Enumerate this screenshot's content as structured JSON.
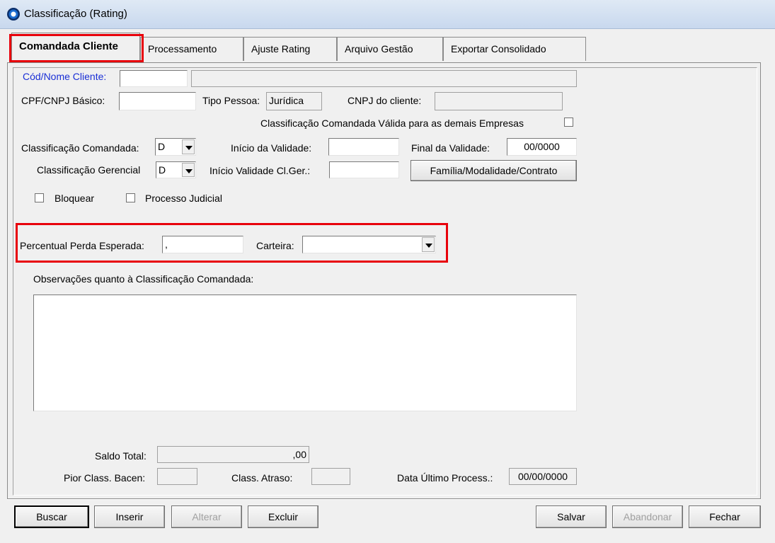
{
  "window": {
    "title": "Classificação (Rating)"
  },
  "tabs": [
    {
      "label": "Comandada Cliente"
    },
    {
      "label": "Processamento"
    },
    {
      "label": "Ajuste Rating"
    },
    {
      "label": "Arquivo Gestão"
    },
    {
      "label": "Exportar Consolidado"
    }
  ],
  "form": {
    "cod_nome_cliente_label": "Cód/Nome Cliente:",
    "cod_cliente_value": "",
    "nome_cliente_value": "",
    "cpf_cnpj_label": "CPF/CNPJ Básico:",
    "cpf_cnpj_value": "",
    "tipo_pessoa_label": "Tipo Pessoa:",
    "tipo_pessoa_value": "Jurídica",
    "cnpj_cliente_label": "CNPJ do cliente:",
    "cnpj_cliente_value": "",
    "classif_valida_label": "Classificação Comandada Válida para as demais Empresas",
    "classif_comandada_label": "Classificação Comandada:",
    "classif_comandada_value": "D",
    "inicio_validade_label": "Início da Validade:",
    "inicio_validade_value": "",
    "final_validade_label": "Final da Validade:",
    "final_validade_value": "00/0000",
    "classif_gerencial_label": "Classificação Gerencial",
    "classif_gerencial_value": "D",
    "inicio_validade_clger_label": "Início Validade Cl.Ger.:",
    "inicio_validade_clger_value": "",
    "familia_button": "Família/Modalidade/Contrato",
    "bloquear_label": "Bloquear",
    "processo_judicial_label": "Processo Judicial",
    "percentual_label": "Percentual Perda Esperada:",
    "percentual_value": ",",
    "carteira_label": "Carteira:",
    "carteira_value": "",
    "observacoes_label": "Observações quanto à Classificação Comandada:",
    "observacoes_value": "",
    "saldo_total_label": "Saldo Total:",
    "saldo_total_value": ",00",
    "pior_class_label": "Pior Class. Bacen:",
    "pior_class_value": "",
    "class_atraso_label": "Class. Atraso:",
    "class_atraso_value": "",
    "data_ultimo_label": "Data Último Process.:",
    "data_ultimo_value": "00/00/0000"
  },
  "buttons": {
    "buscar": "Buscar",
    "inserir": "Inserir",
    "alterar": "Alterar",
    "excluir": "Excluir",
    "salvar": "Salvar",
    "abandonar": "Abandonar",
    "fechar": "Fechar"
  },
  "colors": {
    "highlight": "#e8000b",
    "link_label": "#1a2fd6"
  }
}
